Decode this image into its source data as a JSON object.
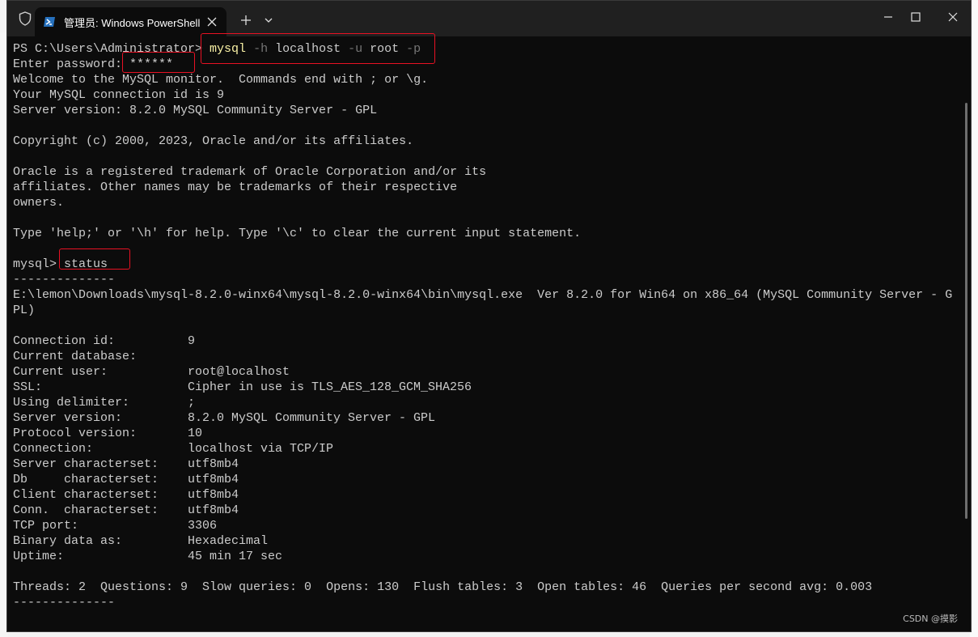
{
  "window": {
    "tab_title": "管理员: Windows PowerShell"
  },
  "terminal": {
    "prompt1": "PS C:\\Users\\Administrator> ",
    "cmd_mysql": "mysql",
    "cmd_opt_h": " -h",
    "cmd_host": " localhost",
    "cmd_opt_u": " -u",
    "cmd_user": " root",
    "cmd_opt_p": " -p",
    "password_label": "Enter password: ",
    "password_value": "******",
    "lines_welcome": [
      "Welcome to the MySQL monitor.  Commands end with ; or \\g.",
      "Your MySQL connection id is 9",
      "Server version: 8.2.0 MySQL Community Server - GPL",
      "",
      "Copyright (c) 2000, 2023, Oracle and/or its affiliates.",
      "",
      "Oracle is a registered trademark of Oracle Corporation and/or its",
      "affiliates. Other names may be trademarks of their respective",
      "owners.",
      "",
      "Type 'help;' or '\\h' for help. Type '\\c' to clear the current input statement.",
      ""
    ],
    "mysql_prompt": "mysql> ",
    "status_cmd": "status",
    "separator": "--------------",
    "exe_line1": "E:\\lemon\\Downloads\\mysql-8.2.0-winx64\\mysql-8.2.0-winx64\\bin\\mysql.exe  Ver 8.2.0 for Win64 on x86_64 (MySQL Community Server - G",
    "exe_line2": "PL)",
    "status_rows": [
      {
        "key": "Connection id:",
        "value": "9"
      },
      {
        "key": "Current database:",
        "value": ""
      },
      {
        "key": "Current user:",
        "value": "root@localhost"
      },
      {
        "key": "SSL:",
        "value": "Cipher in use is TLS_AES_128_GCM_SHA256"
      },
      {
        "key": "Using delimiter:",
        "value": ";"
      },
      {
        "key": "Server version:",
        "value": "8.2.0 MySQL Community Server - GPL"
      },
      {
        "key": "Protocol version:",
        "value": "10"
      },
      {
        "key": "Connection:",
        "value": "localhost via TCP/IP"
      },
      {
        "key": "Server characterset:",
        "value": "utf8mb4"
      },
      {
        "key": "Db     characterset:",
        "value": "utf8mb4"
      },
      {
        "key": "Client characterset:",
        "value": "utf8mb4"
      },
      {
        "key": "Conn.  characterset:",
        "value": "utf8mb4"
      },
      {
        "key": "TCP port:",
        "value": "3306"
      },
      {
        "key": "Binary data as:",
        "value": "Hexadecimal"
      },
      {
        "key": "Uptime:",
        "value": "45 min 17 sec"
      }
    ],
    "threads_line": "Threads: 2  Questions: 9  Slow queries: 0  Opens: 130  Flush tables: 3  Open tables: 46  Queries per second avg: 0.003",
    "separator_end": "--------------"
  },
  "watermark": "CSDN @摸影",
  "colors": {
    "terminal_bg": "#0c0c0c",
    "titlebar_bg": "#202020",
    "text": "#cccccc",
    "command_yellow": "#f9f1a5",
    "option_gray": "#767676",
    "highlight_red": "#e81123"
  },
  "icons": [
    "shield-icon",
    "powershell-icon",
    "close-icon",
    "plus-icon",
    "chevron-down-icon",
    "minimize-icon",
    "maximize-icon"
  ]
}
